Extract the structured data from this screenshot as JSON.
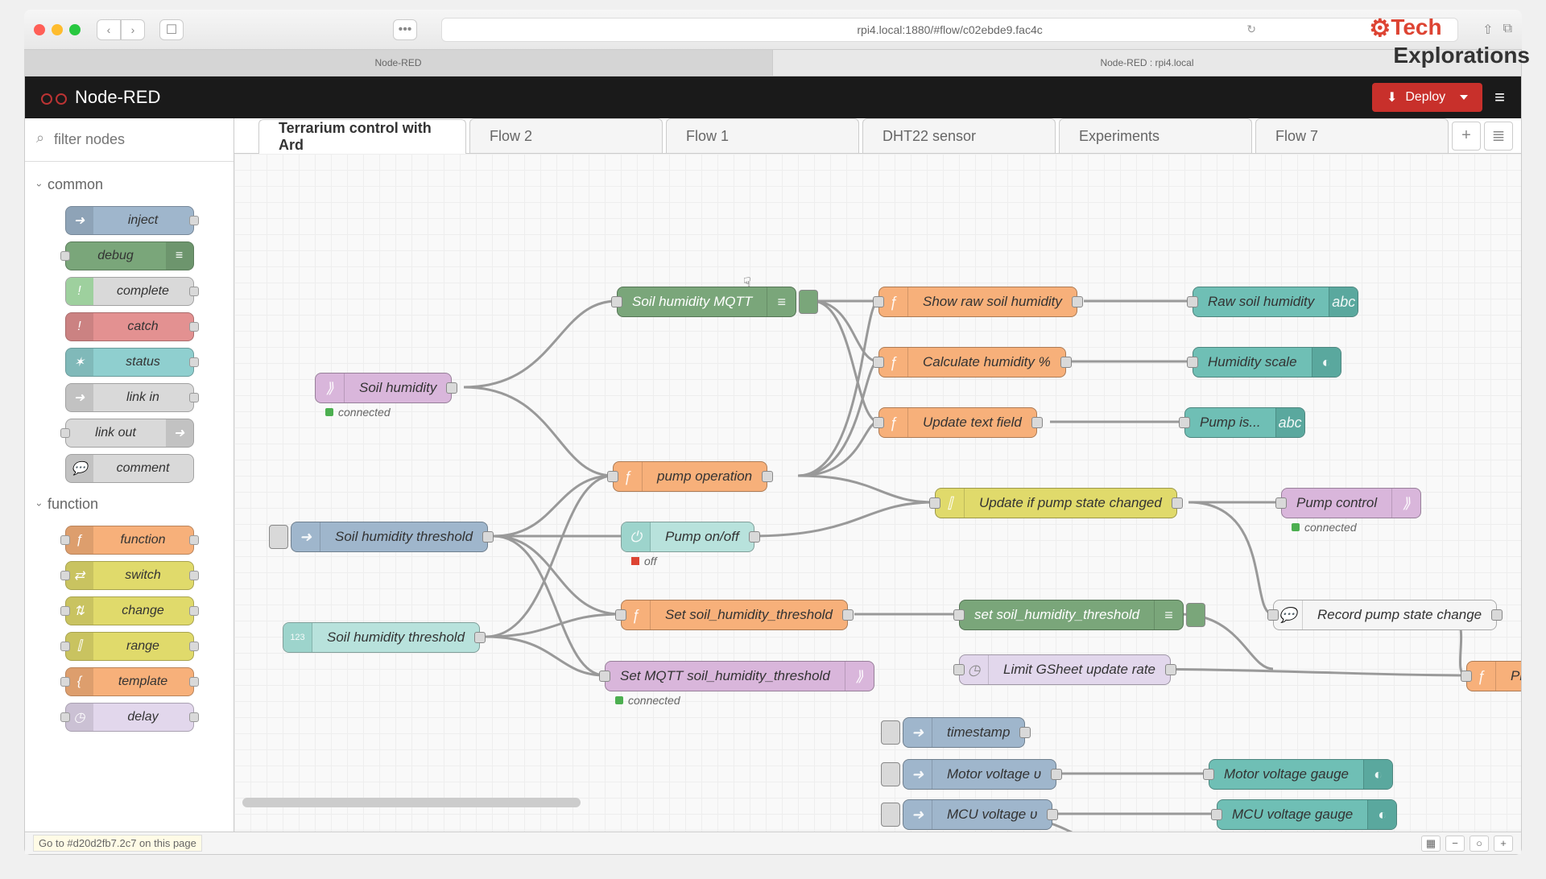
{
  "browser": {
    "url": "rpi4.local:1880/#flow/c02ebde9.fac4c",
    "tabs": [
      "Node-RED",
      "Node-RED : rpi4.local"
    ]
  },
  "watermark": {
    "brand1": "Tech",
    "brand2": "Explorations"
  },
  "header": {
    "title": "Node-RED",
    "deploy": "Deploy"
  },
  "palette": {
    "filter_placeholder": "filter nodes",
    "categories": [
      {
        "name": "common",
        "nodes": [
          {
            "label": "inject",
            "bg": "#9fb6cc",
            "icon": "➜",
            "side": "left",
            "ports": "r"
          },
          {
            "label": "debug",
            "bg": "#7aa67a",
            "icon": "≡",
            "side": "right",
            "ports": "l"
          },
          {
            "label": "complete",
            "bg": "#d9d9d9",
            "icon": "!",
            "iconbg": "#9ed09e",
            "side": "left",
            "ports": "r"
          },
          {
            "label": "catch",
            "bg": "#e39191",
            "icon": "!",
            "side": "left",
            "ports": "r"
          },
          {
            "label": "status",
            "bg": "#8fcfcf",
            "icon": "✶",
            "side": "left",
            "ports": "r"
          },
          {
            "label": "link in",
            "bg": "#d9d9d9",
            "icon": "➜",
            "side": "left",
            "ports": "r"
          },
          {
            "label": "link out",
            "bg": "#d9d9d9",
            "icon": "➜",
            "side": "right",
            "ports": "l"
          },
          {
            "label": "comment",
            "bg": "#d9d9d9",
            "icon": "💬",
            "side": "left",
            "ports": ""
          }
        ]
      },
      {
        "name": "function",
        "nodes": [
          {
            "label": "function",
            "bg": "#f7b07a",
            "icon": "ƒ",
            "side": "left",
            "ports": "lr"
          },
          {
            "label": "switch",
            "bg": "#e0da6b",
            "icon": "⇄",
            "side": "left",
            "ports": "lr"
          },
          {
            "label": "change",
            "bg": "#e0da6b",
            "icon": "⇅",
            "side": "left",
            "ports": "lr"
          },
          {
            "label": "range",
            "bg": "#e0da6b",
            "icon": "⫿",
            "side": "left",
            "ports": "lr"
          },
          {
            "label": "template",
            "bg": "#f7b07a",
            "icon": "{",
            "side": "left",
            "ports": "lr"
          },
          {
            "label": "delay",
            "bg": "#e2d7ec",
            "icon": "◷",
            "side": "left",
            "ports": "lr"
          }
        ]
      }
    ]
  },
  "flowTabs": {
    "tabs": [
      "Terrarium control with Ard",
      "Flow 2",
      "Flow 1",
      "DHT22 sensor",
      "Experiments",
      "Flow 7"
    ],
    "active": 0
  },
  "nodes": {
    "soil_humidity": {
      "label": "Soil humidity",
      "status": "connected"
    },
    "soil_mqtt": {
      "label": "Soil humidity MQTT"
    },
    "show_raw": {
      "label": "Show raw soil humidity"
    },
    "raw_hum": {
      "label": "Raw soil humidity"
    },
    "calc_hum": {
      "label": "Calculate humidity %"
    },
    "hum_scale": {
      "label": "Humidity scale"
    },
    "update_text": {
      "label": "Update text field"
    },
    "pump_is": {
      "label": "Pump is..."
    },
    "pump_op": {
      "label": "pump operation"
    },
    "pump_onoff": {
      "label": "Pump on/off",
      "status": "off"
    },
    "update_pump": {
      "label": "Update if pump state changed"
    },
    "pump_ctrl": {
      "label": "Pump control",
      "status": "connected"
    },
    "sh_thresh1": {
      "label": "Soil humidity threshold"
    },
    "sh_thresh2": {
      "label": "Soil humidity threshold"
    },
    "set_sht": {
      "label": "Set soil_humidity_threshold"
    },
    "set_sht_db": {
      "label": "set soil_humidity_threshold"
    },
    "set_mqtt_sht": {
      "label": "Set MQTT soil_humidity_threshold",
      "status": "connected"
    },
    "record_pump": {
      "label": "Record pump state change"
    },
    "limit_gs": {
      "label": "Limit GSheet update rate"
    },
    "prepa": {
      "label": "Prepa"
    },
    "timestamp": {
      "label": "timestamp"
    },
    "motor_v": {
      "label": "Motor voltage υ"
    },
    "motor_g": {
      "label": "Motor voltage gauge"
    },
    "mcu_v": {
      "label": "MCU voltage υ"
    },
    "mcu_g": {
      "label": "MCU voltage gauge"
    }
  },
  "footer": {
    "status": "Go to #d20d2fb7.2c7 on this page"
  }
}
